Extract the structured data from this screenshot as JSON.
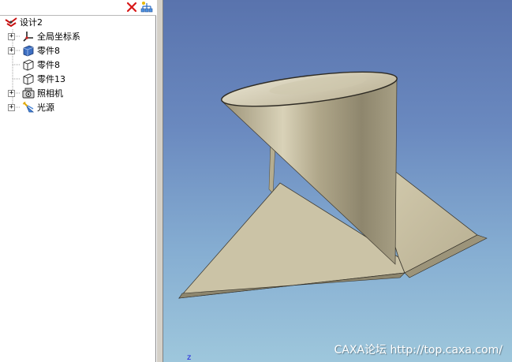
{
  "tree": {
    "root_label": "设计2",
    "items": [
      {
        "label": "全局坐标系",
        "icon": "coordinate-system-icon",
        "expandable": true
      },
      {
        "label": "零件8",
        "icon": "part-solid-icon",
        "expandable": true
      },
      {
        "label": "零件8",
        "icon": "part-outline-icon",
        "expandable": false
      },
      {
        "label": "零件13",
        "icon": "part-outline-icon",
        "expandable": false
      },
      {
        "label": "照相机",
        "icon": "camera-icon",
        "expandable": true
      },
      {
        "label": "光源",
        "icon": "light-source-icon",
        "expandable": true
      }
    ]
  },
  "toolbar": {
    "close_icon": "close-icon",
    "hierarchy_icon": "hierarchy-icon"
  },
  "viewport": {
    "watermark": "CAXA论坛 http://top.caxa.com/",
    "axis_label": "z"
  },
  "colors": {
    "background_top": "#5973ad",
    "background_bottom": "#9ec7dc",
    "model": "#c2b99d"
  }
}
